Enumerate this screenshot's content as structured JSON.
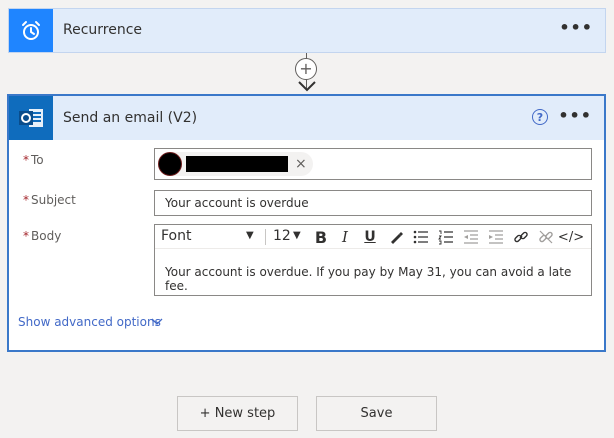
{
  "recurrence": {
    "title": "Recurrence",
    "more": "•••"
  },
  "connector": {
    "add_symbol": "+"
  },
  "email": {
    "title": "Send an email (V2)",
    "help_symbol": "?",
    "more": "•••",
    "to": {
      "label": "To",
      "required_mark": "*",
      "recipient_name": "",
      "remove_symbol": "×"
    },
    "subject": {
      "label": "Subject",
      "required_mark": "*",
      "value": "Your account is overdue"
    },
    "body": {
      "label": "Body",
      "required_mark": "*",
      "font": "Font",
      "font_size": "12",
      "bold": "B",
      "italic": "I",
      "underline": "U",
      "code": "</>",
      "text": "Your account is overdue. If you pay by May 31, you can avoid a late fee."
    },
    "advanced_options": "Show advanced options"
  },
  "footer": {
    "new_step": "+ New step",
    "save": "Save"
  },
  "colors": {
    "accent": "#3a78c9",
    "recurrence_icon": "#1f85ff",
    "outlook_icon": "#0f6cbd",
    "link": "#4269c7",
    "required": "#a4262c"
  }
}
